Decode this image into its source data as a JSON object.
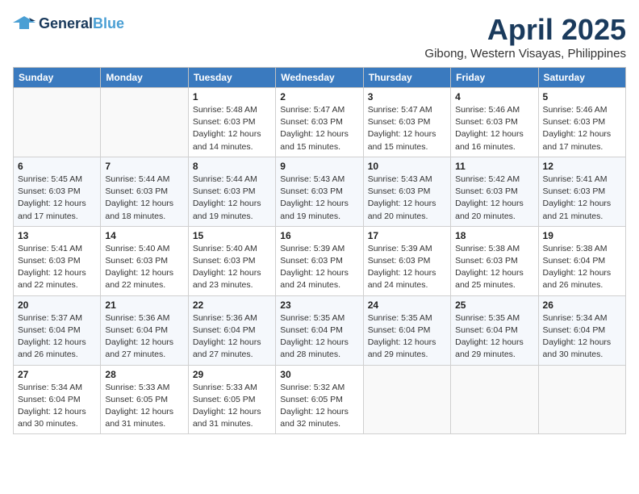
{
  "logo": {
    "line1": "General",
    "line2": "Blue"
  },
  "title": "April 2025",
  "location": "Gibong, Western Visayas, Philippines",
  "weekdays": [
    "Sunday",
    "Monday",
    "Tuesday",
    "Wednesday",
    "Thursday",
    "Friday",
    "Saturday"
  ],
  "weeks": [
    [
      null,
      null,
      {
        "day": 1,
        "sunrise": "5:48 AM",
        "sunset": "6:03 PM",
        "daylight": "12 hours and 14 minutes."
      },
      {
        "day": 2,
        "sunrise": "5:47 AM",
        "sunset": "6:03 PM",
        "daylight": "12 hours and 15 minutes."
      },
      {
        "day": 3,
        "sunrise": "5:47 AM",
        "sunset": "6:03 PM",
        "daylight": "12 hours and 15 minutes."
      },
      {
        "day": 4,
        "sunrise": "5:46 AM",
        "sunset": "6:03 PM",
        "daylight": "12 hours and 16 minutes."
      },
      {
        "day": 5,
        "sunrise": "5:46 AM",
        "sunset": "6:03 PM",
        "daylight": "12 hours and 17 minutes."
      }
    ],
    [
      {
        "day": 6,
        "sunrise": "5:45 AM",
        "sunset": "6:03 PM",
        "daylight": "12 hours and 17 minutes."
      },
      {
        "day": 7,
        "sunrise": "5:44 AM",
        "sunset": "6:03 PM",
        "daylight": "12 hours and 18 minutes."
      },
      {
        "day": 8,
        "sunrise": "5:44 AM",
        "sunset": "6:03 PM",
        "daylight": "12 hours and 19 minutes."
      },
      {
        "day": 9,
        "sunrise": "5:43 AM",
        "sunset": "6:03 PM",
        "daylight": "12 hours and 19 minutes."
      },
      {
        "day": 10,
        "sunrise": "5:43 AM",
        "sunset": "6:03 PM",
        "daylight": "12 hours and 20 minutes."
      },
      {
        "day": 11,
        "sunrise": "5:42 AM",
        "sunset": "6:03 PM",
        "daylight": "12 hours and 20 minutes."
      },
      {
        "day": 12,
        "sunrise": "5:41 AM",
        "sunset": "6:03 PM",
        "daylight": "12 hours and 21 minutes."
      }
    ],
    [
      {
        "day": 13,
        "sunrise": "5:41 AM",
        "sunset": "6:03 PM",
        "daylight": "12 hours and 22 minutes."
      },
      {
        "day": 14,
        "sunrise": "5:40 AM",
        "sunset": "6:03 PM",
        "daylight": "12 hours and 22 minutes."
      },
      {
        "day": 15,
        "sunrise": "5:40 AM",
        "sunset": "6:03 PM",
        "daylight": "12 hours and 23 minutes."
      },
      {
        "day": 16,
        "sunrise": "5:39 AM",
        "sunset": "6:03 PM",
        "daylight": "12 hours and 24 minutes."
      },
      {
        "day": 17,
        "sunrise": "5:39 AM",
        "sunset": "6:03 PM",
        "daylight": "12 hours and 24 minutes."
      },
      {
        "day": 18,
        "sunrise": "5:38 AM",
        "sunset": "6:03 PM",
        "daylight": "12 hours and 25 minutes."
      },
      {
        "day": 19,
        "sunrise": "5:38 AM",
        "sunset": "6:04 PM",
        "daylight": "12 hours and 26 minutes."
      }
    ],
    [
      {
        "day": 20,
        "sunrise": "5:37 AM",
        "sunset": "6:04 PM",
        "daylight": "12 hours and 26 minutes."
      },
      {
        "day": 21,
        "sunrise": "5:36 AM",
        "sunset": "6:04 PM",
        "daylight": "12 hours and 27 minutes."
      },
      {
        "day": 22,
        "sunrise": "5:36 AM",
        "sunset": "6:04 PM",
        "daylight": "12 hours and 27 minutes."
      },
      {
        "day": 23,
        "sunrise": "5:35 AM",
        "sunset": "6:04 PM",
        "daylight": "12 hours and 28 minutes."
      },
      {
        "day": 24,
        "sunrise": "5:35 AM",
        "sunset": "6:04 PM",
        "daylight": "12 hours and 29 minutes."
      },
      {
        "day": 25,
        "sunrise": "5:35 AM",
        "sunset": "6:04 PM",
        "daylight": "12 hours and 29 minutes."
      },
      {
        "day": 26,
        "sunrise": "5:34 AM",
        "sunset": "6:04 PM",
        "daylight": "12 hours and 30 minutes."
      }
    ],
    [
      {
        "day": 27,
        "sunrise": "5:34 AM",
        "sunset": "6:04 PM",
        "daylight": "12 hours and 30 minutes."
      },
      {
        "day": 28,
        "sunrise": "5:33 AM",
        "sunset": "6:05 PM",
        "daylight": "12 hours and 31 minutes."
      },
      {
        "day": 29,
        "sunrise": "5:33 AM",
        "sunset": "6:05 PM",
        "daylight": "12 hours and 31 minutes."
      },
      {
        "day": 30,
        "sunrise": "5:32 AM",
        "sunset": "6:05 PM",
        "daylight": "12 hours and 32 minutes."
      },
      null,
      null,
      null
    ]
  ]
}
